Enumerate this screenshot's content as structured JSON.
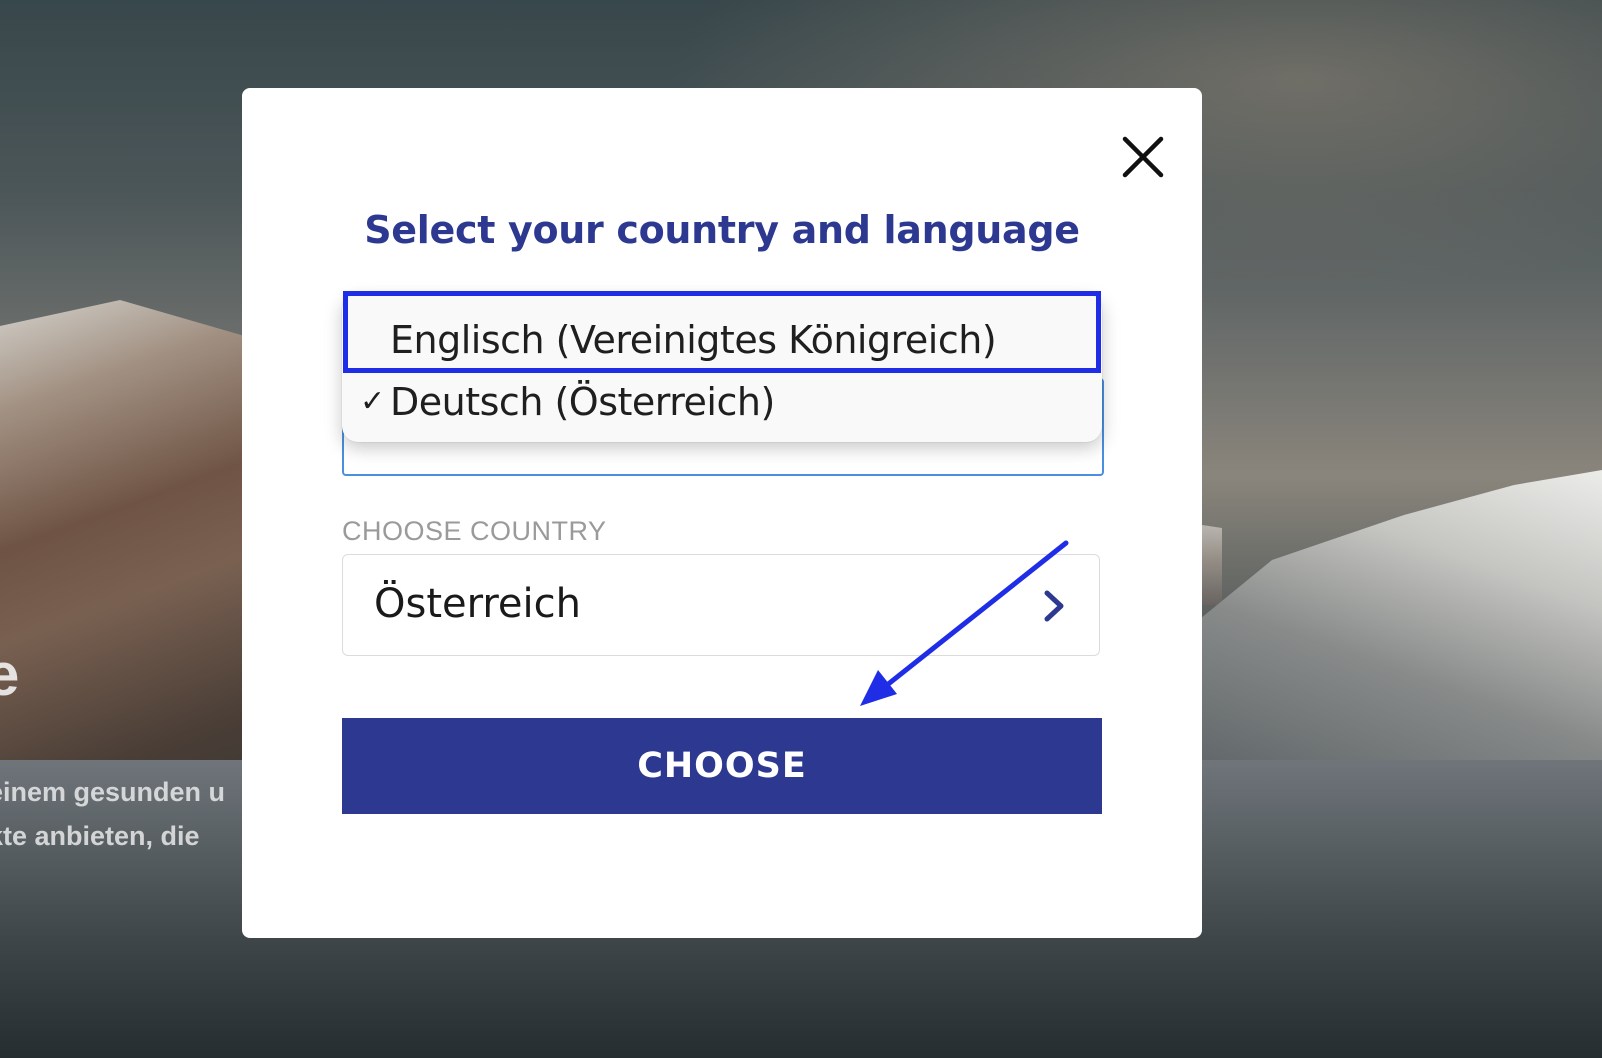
{
  "background": {
    "heading_fragment": "e",
    "text_line_1": "einem gesunden u",
    "text_line_2": "kte anbieten, die"
  },
  "modal": {
    "title": "Select your country and language",
    "close_icon": "close-icon",
    "language_dropdown": {
      "options": [
        {
          "label": "Englisch (Vereinigtes Königreich)",
          "selected": false,
          "highlighted": true
        },
        {
          "label": "Deutsch (Österreich)",
          "selected": true,
          "check_mark": "✓"
        }
      ]
    },
    "country": {
      "label": "CHOOSE COUNTRY",
      "value": "Österreich",
      "icon": "chevron-right-icon"
    },
    "choose_button": "CHOOSE"
  },
  "colors": {
    "brand": "#2d3990",
    "annotation": "#1f2ee6",
    "focus_border": "#4a8fe0"
  }
}
